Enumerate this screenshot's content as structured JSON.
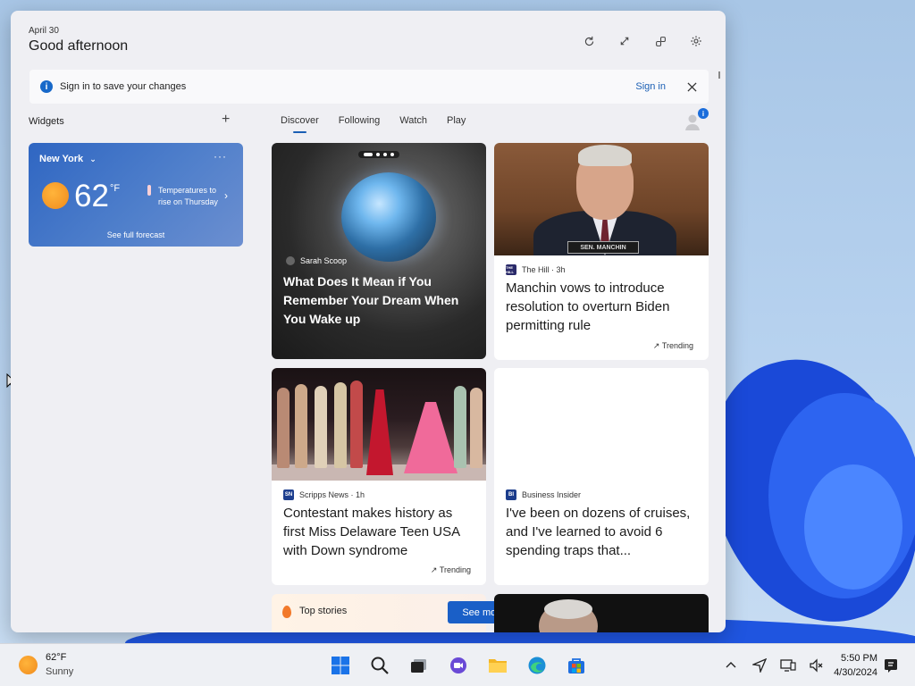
{
  "header": {
    "date": "April 30",
    "greeting": "Good afternoon"
  },
  "signin_bar": {
    "message": "Sign in to save your changes",
    "link": "Sign in"
  },
  "widgets": {
    "label": "Widgets",
    "add_symbol": "+"
  },
  "tabs": [
    {
      "label": "Discover",
      "active": true
    },
    {
      "label": "Following",
      "active": false
    },
    {
      "label": "Watch",
      "active": false
    },
    {
      "label": "Play",
      "active": false
    }
  ],
  "profile_badge": "i",
  "weather": {
    "city": "New York",
    "more": "···",
    "temp": "62",
    "unit": "°F",
    "note": "Temperatures to rise on Thursday",
    "forecast_link": "See full forecast"
  },
  "cards": [
    {
      "source": "Sarah Scoop",
      "headline": "What Does It Mean if You Remember Your Dream When You Wake up"
    },
    {
      "source": "The Hill · 3h",
      "logo": "THE HILL",
      "headline": "Manchin vows to introduce resolution to overturn Biden permitting rule",
      "trend": "Trending",
      "nameplate": "SEN. MANCHIN"
    },
    {
      "source": "Scripps News · 1h",
      "logo": "SN",
      "headline": "Contestant makes history as first Miss Delaware Teen USA with Down syndrome",
      "trend": "Trending"
    },
    {
      "source": "Business Insider",
      "logo": "BI",
      "headline": "I've been on dozens of cruises, and I've learned to avoid 6 spending traps that..."
    }
  ],
  "top_stories": {
    "label": "Top stories",
    "button": "See more"
  },
  "taskbar": {
    "weather_temp": "62°F",
    "weather_cond": "Sunny",
    "time": "5:50 PM",
    "date": "4/30/2024"
  },
  "colors": {
    "accent": "#1a5fc7",
    "panel_bg": "#efeff3",
    "weather_bg": "#3a6fc6"
  }
}
